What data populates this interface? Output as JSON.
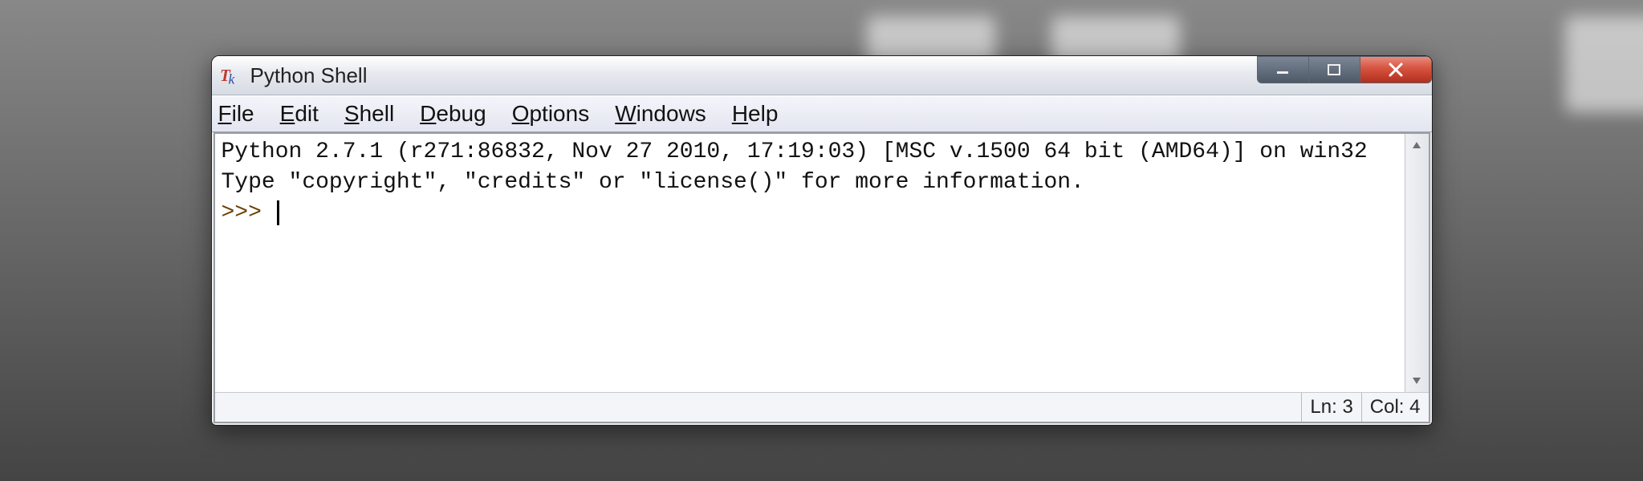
{
  "window": {
    "title": "Python Shell",
    "icon_name": "tk-logo-icon",
    "controls": {
      "minimize_name": "minimize-icon",
      "maximize_name": "maximize-icon",
      "close_name": "close-icon"
    }
  },
  "menu": {
    "items": [
      {
        "name": "menu-file",
        "mnemonic": "F",
        "rest": "ile"
      },
      {
        "name": "menu-edit",
        "mnemonic": "E",
        "rest": "dit"
      },
      {
        "name": "menu-shell",
        "mnemonic": "S",
        "rest": "hell"
      },
      {
        "name": "menu-debug",
        "mnemonic": "D",
        "rest": "ebug"
      },
      {
        "name": "menu-options",
        "mnemonic": "O",
        "rest": "ptions"
      },
      {
        "name": "menu-windows",
        "mnemonic": "W",
        "rest": "indows"
      },
      {
        "name": "menu-help",
        "mnemonic": "H",
        "rest": "elp"
      }
    ]
  },
  "shell": {
    "banner_line1": "Python 2.7.1 (r271:86832, Nov 27 2010, 17:19:03) [MSC v.1500 64 bit (AMD64)] on win32",
    "banner_line2": "Type \"copyright\", \"credits\" or \"license()\" for more information.",
    "prompt": ">>> "
  },
  "status": {
    "line_label": "Ln: 3",
    "col_label": "Col: 4"
  }
}
